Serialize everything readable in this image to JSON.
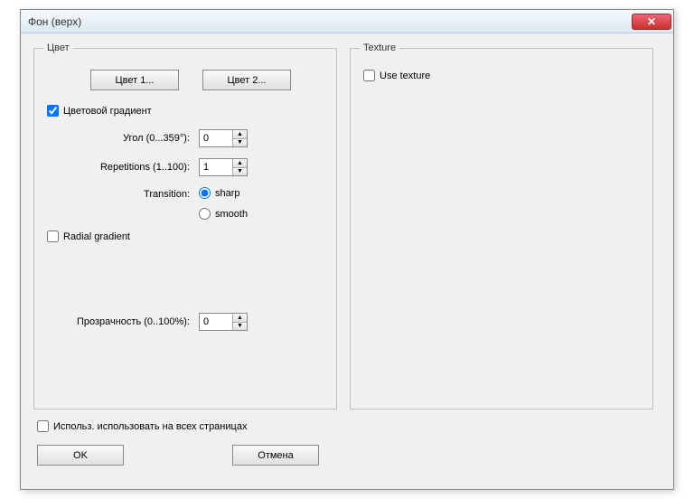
{
  "window": {
    "title": "Фон (верх)"
  },
  "color": {
    "legend": "Цвет",
    "btn1": "Цвет 1...",
    "btn2": "Цвет 2...",
    "gradient_check": "Цветовой градиент",
    "angle_label": "Угол (0...359°):",
    "angle_value": "0",
    "reps_label": "Repetitions (1..100):",
    "reps_value": "1",
    "transition_label": "Transition:",
    "sharp": "sharp",
    "smooth": "smooth",
    "radial_check": "Radial gradient",
    "opacity_label": "Прозрачность (0..100%):",
    "opacity_value": "0"
  },
  "texture": {
    "legend": "Texture",
    "use_check": "Use texture"
  },
  "bottom": {
    "all_pages": "Использ. использовать на всех страницах",
    "ok": "OK",
    "cancel": "Отмена"
  }
}
